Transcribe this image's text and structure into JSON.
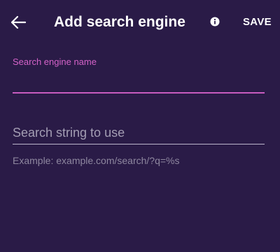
{
  "toolbar": {
    "back_icon": "arrow-left-icon",
    "title": "Add search engine",
    "info_icon": "info-icon",
    "save_label": "SAVE"
  },
  "form": {
    "name_field": {
      "label": "Search engine name",
      "value": ""
    },
    "string_field": {
      "placeholder": "Search string to use",
      "value": "",
      "helper": "Example: example.com/search/?q=%s"
    }
  },
  "colors": {
    "background": "#2a1b47",
    "accent": "#d462c8",
    "text": "#ffffff",
    "hint": "#a49eb4"
  }
}
